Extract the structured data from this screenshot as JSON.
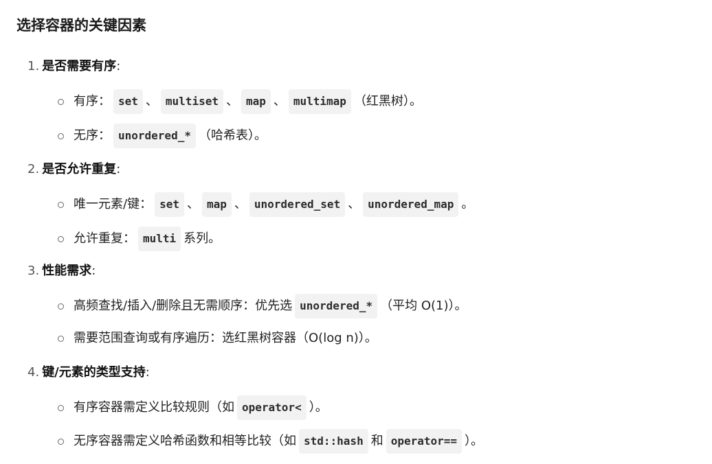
{
  "title": "选择容器的关键因素",
  "sections": [
    {
      "num": "1.",
      "heading": "是否需要有序",
      "colon": ":",
      "items": [
        {
          "prefix": "有序：",
          "codes": [
            "set",
            "multiset",
            "map",
            "multimap"
          ],
          "sep": "、",
          "suffix": "（红黑树）。"
        },
        {
          "prefix": "无序：",
          "codes": [
            "unordered_*"
          ],
          "suffix": "（哈希表）。"
        }
      ]
    },
    {
      "num": "2.",
      "heading": "是否允许重复",
      "colon": ":",
      "items": [
        {
          "prefix": "唯一元素/键：",
          "codes": [
            "set",
            "map",
            "unordered_set",
            "unordered_map"
          ],
          "sep": "、",
          "suffix": "。"
        },
        {
          "prefix": "允许重复：",
          "codes": [
            "multi"
          ],
          "suffix": "系列。"
        }
      ]
    },
    {
      "num": "3.",
      "heading": "性能需求",
      "colon": ":",
      "items": [
        {
          "prefix": "高频查找/插入/删除且无需顺序：优先选",
          "codes": [
            "unordered_*"
          ],
          "suffix": "（平均 O(1)）。"
        },
        {
          "prefix": "需要范围查询或有序遍历：选红黑树容器（O(log n)）。"
        }
      ]
    },
    {
      "num": "4.",
      "heading": "键/元素的类型支持",
      "colon": ":",
      "items": [
        {
          "prefix": "有序容器需定义比较规则（如",
          "codes": [
            "operator<"
          ],
          "suffix": "）。"
        },
        {
          "prefix": "无序容器需定义哈希函数和相等比较（如",
          "codes": [
            "std::hash",
            "operator=="
          ],
          "sep": "和",
          "suffix": "）。"
        }
      ]
    }
  ]
}
